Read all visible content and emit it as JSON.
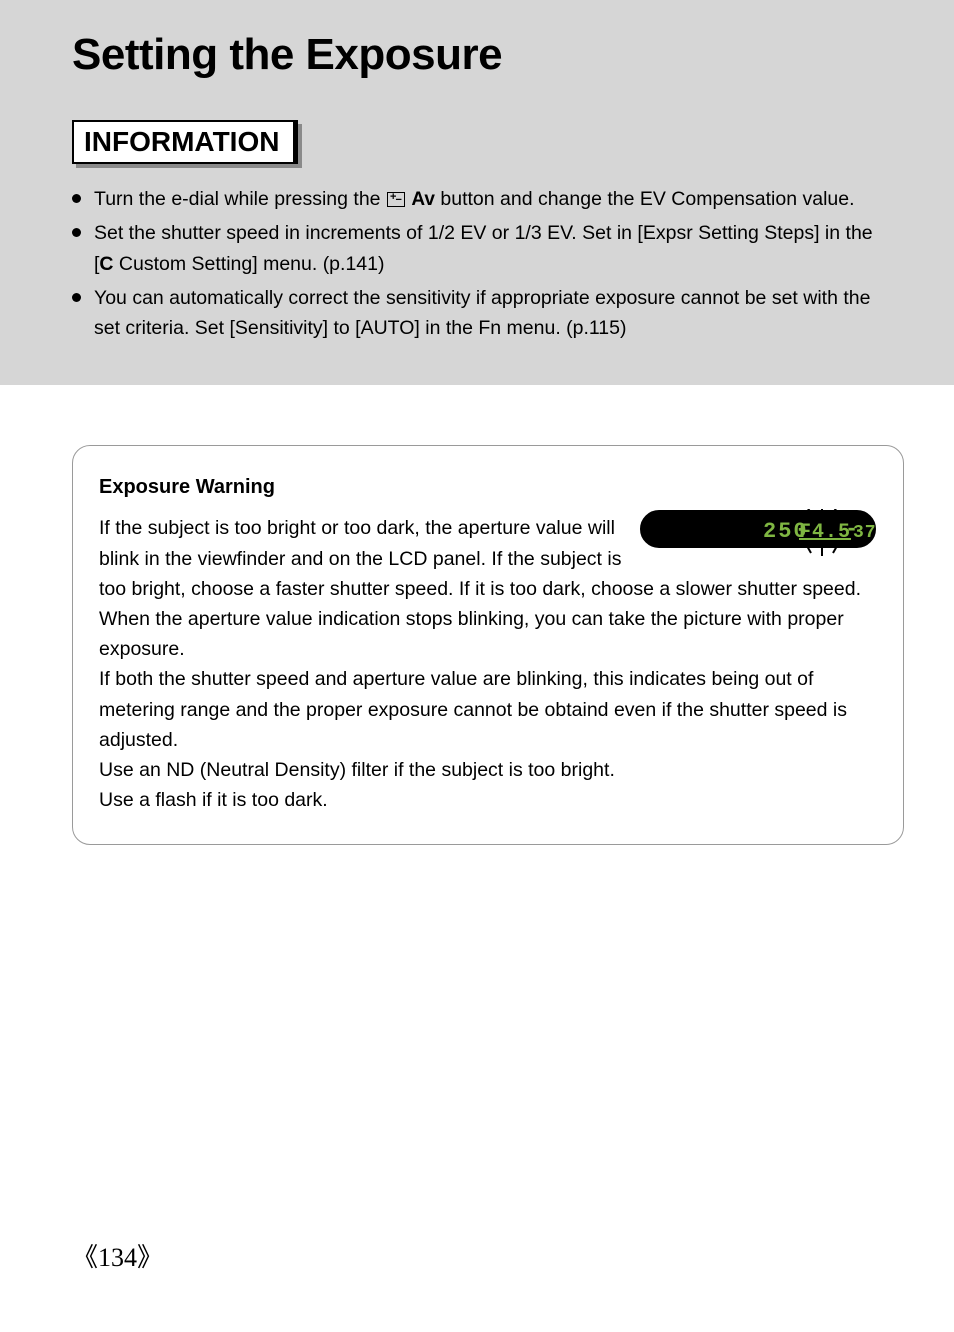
{
  "title": "Setting the Exposure",
  "info": {
    "heading": "INFORMATION",
    "items": [
      {
        "pre": "Turn the e-dial while pressing the ",
        "av": "Av",
        "post": " button and change the EV Compensation value."
      },
      {
        "pre": "Set the shutter speed in increments of 1/2 EV or 1/3 EV. Set in [Expsr Setting Steps] in the [",
        "c": "C",
        "post": " Custom Setting] menu. (p.141)"
      },
      {
        "text": "You can automatically correct the sensitivity if appropriate exposure cannot be set with the set criteria. Set [Sensitivity] to [AUTO] in the Fn menu. (p.115)"
      }
    ]
  },
  "warning": {
    "title": "Exposure Warning",
    "p1": "If the subject is too bright or too dark, the aperture value will blink in the viewfinder and on the LCD panel. If the subject is too bright, choose a faster shutter speed. If it is too dark, choose a slower shutter speed. When the aperture value indication stops blinking, you can take the picture with proper exposure.",
    "p2": "If both the shutter speed and aperture value are blinking, this indicates being out of metering range and the proper exposure cannot be obtaind even if the shutter speed is adjusted.",
    "p3": "Use an ND (Neutral Density) filter if the subject is too bright.",
    "p4": "Use a flash if it is too dark.",
    "lcd": {
      "shutter": "250",
      "aperture": "F4.5",
      "comp_sign": "-",
      "comp_val": "37"
    }
  },
  "page_number": "134"
}
